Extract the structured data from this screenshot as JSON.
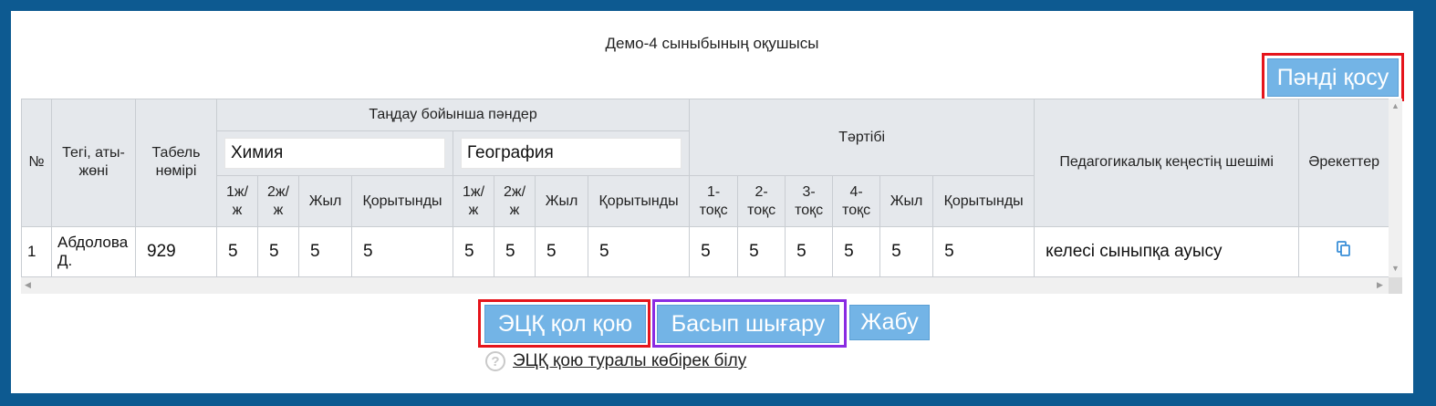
{
  "title": "Демо-4 сыныбының оқушысы",
  "buttons": {
    "add_subject": "Пәнді қосу",
    "sign": "ЭЦҚ қол қою",
    "print": "Басып шығару",
    "close": "Жабу"
  },
  "help_link": "ЭЦҚ қою туралы көбірек білу",
  "table": {
    "headers": {
      "number": "№",
      "name": "Тегі, аты-жөні",
      "tabel": "Табель нөмірі",
      "elective": "Таңдау бойынша пәндер",
      "conduct": "Тәртібі",
      "decision": "Педагогикалық кеңестің шешімі",
      "actions": "Әрекеттер"
    },
    "subjects": [
      "Химия",
      "География"
    ],
    "subject_subcols": [
      "1ж/ж",
      "2ж/ж",
      "Жыл",
      "Қорытынды"
    ],
    "conduct_subcols": [
      "1-тоқс",
      "2-тоқс",
      "3-тоқс",
      "4-тоқс",
      "Жыл",
      "Қорытынды"
    ],
    "rows": [
      {
        "number": "1",
        "name": "Абдолова Д.",
        "tabel": "929",
        "grades": [
          "5",
          "5",
          "5",
          "5",
          "5",
          "5",
          "5",
          "5"
        ],
        "conduct": [
          "5",
          "5",
          "5",
          "5",
          "5",
          "5"
        ],
        "decision": "келесі сыныпқа ауысу"
      }
    ]
  },
  "icons": {
    "copy": "copy-icon",
    "help": "question-icon"
  },
  "colors": {
    "frame_bg": "#0d5a91",
    "button_bg": "#73b4e6",
    "highlight_red": "#e5141b",
    "highlight_purple": "#8a2be2",
    "copy_icon": "#3a8fd8"
  }
}
